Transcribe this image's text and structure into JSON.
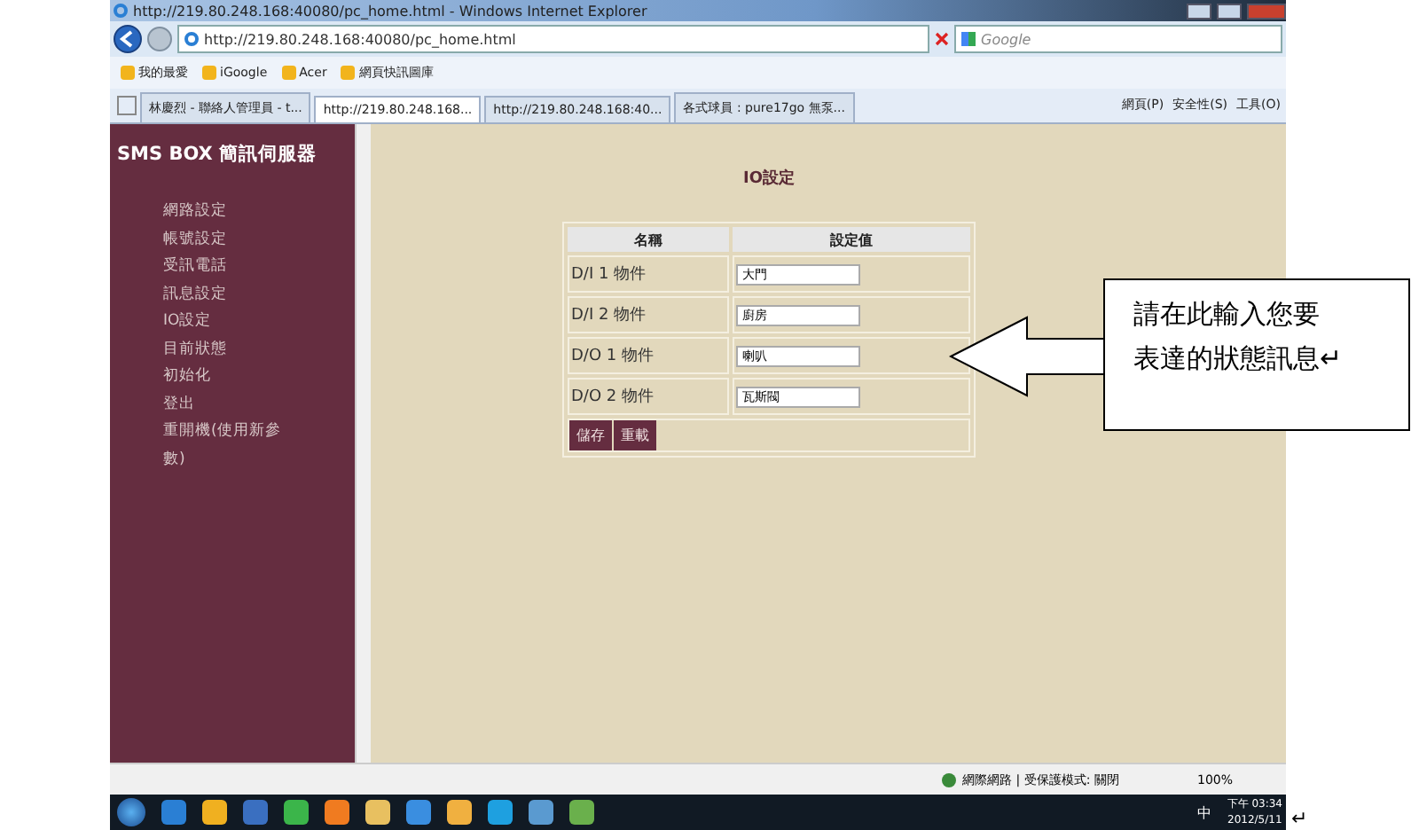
{
  "browser": {
    "title": "http://219.80.248.168:40080/pc_home.html - Windows Internet Explorer",
    "url": "http://219.80.248.168:40080/pc_home.html",
    "search_placeholder": "Google",
    "favorites": [
      "我的最愛",
      "iGoogle",
      "Acer",
      "網頁快訊圖庫"
    ],
    "tabs": [
      {
        "label": "林慶烈 - 聯絡人管理員 - t...",
        "selected": false
      },
      {
        "label": "http://219.80.248.168...",
        "selected": true
      },
      {
        "label": "http://219.80.248.168:40...",
        "selected": false
      },
      {
        "label": "各式球員 : pure17go 無泵...",
        "selected": false
      }
    ],
    "menus": [
      "網頁(P)",
      "安全性(S)",
      "工具(O)"
    ],
    "status": "網際網路 | 受保護模式: 關閉",
    "zoom": "100%"
  },
  "page": {
    "brand": "SMS BOX 簡訊伺服器",
    "nav": [
      "網路設定",
      "帳號設定",
      "受訊電話",
      "訊息設定",
      "IO設定",
      "目前狀態",
      "初始化",
      "登出",
      "重開機(使用新參數)"
    ],
    "heading": "IO設定",
    "columns": [
      "名稱",
      "設定值"
    ],
    "rows": [
      {
        "name": "D/I 1 物件",
        "value": "大門"
      },
      {
        "name": "D/I 2 物件",
        "value": "廚房"
      },
      {
        "name": "D/O 1 物件",
        "value": "喇叭"
      },
      {
        "name": "D/O 2 物件",
        "value": "瓦斯閥"
      }
    ],
    "buttons": [
      "儲存",
      "重載"
    ]
  },
  "taskbar": {
    "ime": "中",
    "time": "下午 03:34",
    "date": "2012/5/11"
  },
  "callout": {
    "lines": [
      "請在此輸入您要",
      "表達的狀態訊息↵"
    ]
  },
  "doc_mark": "↵"
}
